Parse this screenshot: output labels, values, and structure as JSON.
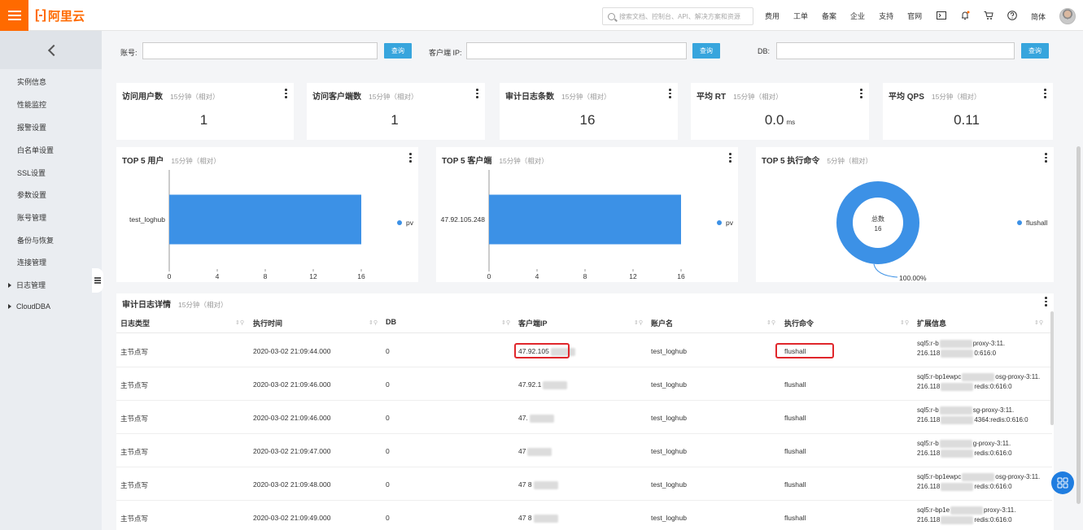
{
  "header": {
    "logo_text": "阿里云",
    "logo_mark": "[-]",
    "search_placeholder": "搜索文档、控制台、API、解决方案和资源",
    "nav": [
      "费用",
      "工单",
      "备案",
      "企业",
      "支持",
      "官网"
    ],
    "lang": "简体",
    "brand_color": "#ff6a00"
  },
  "sidebar": {
    "items": [
      "实例信息",
      "性能监控",
      "报警设置",
      "白名单设置",
      "SSL设置",
      "参数设置",
      "账号管理",
      "备份与恢复",
      "连接管理"
    ],
    "groups": [
      "日志管理",
      "CloudDBA"
    ]
  },
  "filters": {
    "account_label": "账号:",
    "client_ip_label": "客户端 IP:",
    "db_label": "DB:",
    "query_label": "查询"
  },
  "metrics": [
    {
      "title": "访问用户数",
      "sub": "15分钟（相对）",
      "value": "1",
      "unit": ""
    },
    {
      "title": "访问客户端数",
      "sub": "15分钟（相对）",
      "value": "1",
      "unit": ""
    },
    {
      "title": "审计日志条数",
      "sub": "15分钟（相对）",
      "value": "16",
      "unit": ""
    },
    {
      "title": "平均 RT",
      "sub": "15分钟（相对）",
      "value": "0.0",
      "unit": "ms"
    },
    {
      "title": "平均 QPS",
      "sub": "15分钟（相对）",
      "value": "0.11",
      "unit": ""
    }
  ],
  "charts": {
    "top_users": {
      "title": "TOP 5 用户",
      "sub": "15分钟（相对）"
    },
    "top_clients": {
      "title": "TOP 5 客户端",
      "sub": "15分钟（相对）"
    },
    "top_commands": {
      "title": "TOP 5 执行命令",
      "sub": "5分钟（相对）",
      "center_label": "总数",
      "center_value": "16",
      "slice_label": "100.00%"
    }
  },
  "chart_data": [
    {
      "type": "bar",
      "orientation": "horizontal",
      "categories": [
        "test_loghub"
      ],
      "series": [
        {
          "name": "pv",
          "values": [
            16
          ]
        }
      ],
      "xlim": [
        0,
        16
      ],
      "xticks": [
        0,
        4,
        8,
        12,
        16
      ],
      "legend": "right"
    },
    {
      "type": "bar",
      "orientation": "horizontal",
      "categories": [
        "47.92.105.248"
      ],
      "series": [
        {
          "name": "pv",
          "values": [
            16
          ]
        }
      ],
      "xlim": [
        0,
        16
      ],
      "xticks": [
        0,
        4,
        8,
        12,
        16
      ],
      "legend": "right"
    },
    {
      "type": "pie",
      "donut": true,
      "categories": [
        "flushall"
      ],
      "values": [
        16
      ],
      "labels": [
        "100.00%"
      ],
      "legend": "right"
    }
  ],
  "table": {
    "title": "审计日志详情",
    "sub": "15分钟（相对）",
    "columns": [
      "日志类型",
      "执行时间",
      "DB",
      "客户端IP",
      "账户名",
      "执行命令",
      "扩展信息"
    ],
    "rows": [
      {
        "type": "主节点写",
        "time": "2020-03-02 21:09:44.000",
        "db": "0",
        "ip": "47.92.105",
        "user": "test_loghub",
        "cmd": "flushall",
        "ext1": "sql5:r-b",
        "ext1b": "proxy-3:11.",
        "ext2": "216.118",
        "ext2b": "0:616:0"
      },
      {
        "type": "主节点写",
        "time": "2020-03-02 21:09:46.000",
        "db": "0",
        "ip": "47.92.1",
        "user": "test_loghub",
        "cmd": "flushall",
        "ext1": "sql5:r-bp1ewpc",
        "ext1b": "osg-proxy-3:11.",
        "ext2": "216.118",
        "ext2b": "redis:0:616:0"
      },
      {
        "type": "主节点写",
        "time": "2020-03-02 21:09:46.000",
        "db": "0",
        "ip": "47.",
        "user": "test_loghub",
        "cmd": "flushall",
        "ext1": "sql5:r-b",
        "ext1b": "sg-proxy-3:11.",
        "ext2": "216.118",
        "ext2b": "4364:redis:0:616:0"
      },
      {
        "type": "主节点写",
        "time": "2020-03-02 21:09:47.000",
        "db": "0",
        "ip": "47",
        "user": "test_loghub",
        "cmd": "flushall",
        "ext1": "sql5:r-b",
        "ext1b": "g-proxy-3:11.",
        "ext2": "216.118",
        "ext2b": "redis:0:616:0"
      },
      {
        "type": "主节点写",
        "time": "2020-03-02 21:09:48.000",
        "db": "0",
        "ip": "47 8",
        "user": "test_loghub",
        "cmd": "flushall",
        "ext1": "sql5:r-bp1ewpc",
        "ext1b": "osg-proxy-3:11.",
        "ext2": "216.118",
        "ext2b": "redis:0:616:0"
      },
      {
        "type": "主节点写",
        "time": "2020-03-02 21:09:49.000",
        "db": "0",
        "ip": "47 8",
        "user": "test_loghub",
        "cmd": "flushall",
        "ext1": "sql5:r-bp1e",
        "ext1b": "proxy-3:11.",
        "ext2": "216.118",
        "ext2b": "redis:0:616:0"
      }
    ]
  },
  "colors": {
    "accent": "#37a5dd",
    "bar": "#3c91e6",
    "highlight": "#e0262b"
  }
}
